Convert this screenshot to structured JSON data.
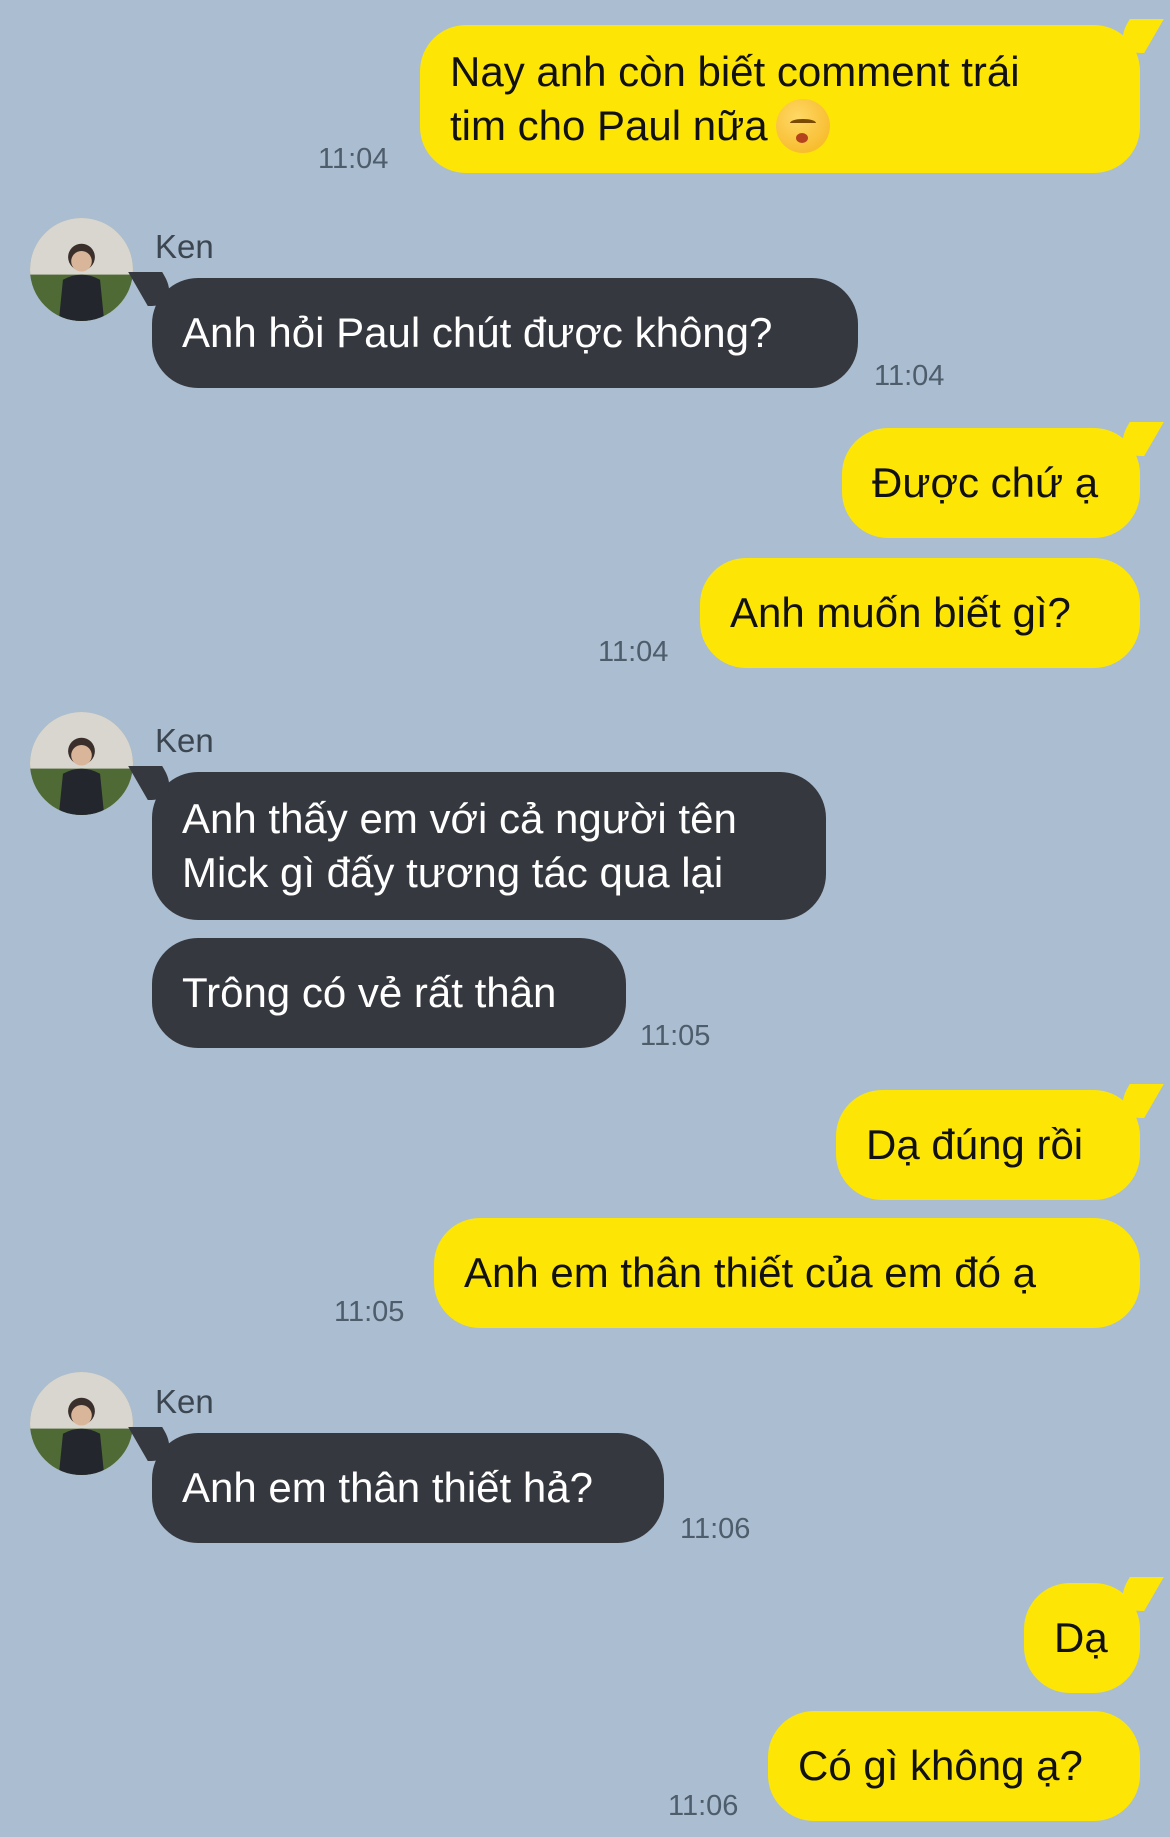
{
  "contact_name": "Ken",
  "messages": [
    {
      "from": "me",
      "text1": "Nay anh còn biết comment trái",
      "text2": "tim cho Paul nữa",
      "emoji": "kissing-face-with-closed-eyes-icon"
    },
    {
      "from": "them",
      "text": "Anh hỏi Paul chút được không?"
    },
    {
      "from": "me",
      "text": "Được chứ ạ"
    },
    {
      "from": "me",
      "text": "Anh muốn biết gì?"
    },
    {
      "from": "them",
      "text1": "Anh thấy em với cả người tên",
      "text2": "Mick gì đấy tương tác qua lại"
    },
    {
      "from": "them",
      "text": "Trông có vẻ rất thân"
    },
    {
      "from": "me",
      "text": "Dạ đúng rồi"
    },
    {
      "from": "me",
      "text": "Anh em thân thiết của em đó ạ"
    },
    {
      "from": "them",
      "text": "Anh em thân thiết hả?"
    },
    {
      "from": "me",
      "text": "Dạ"
    },
    {
      "from": "me",
      "text": "Có gì không ạ?"
    }
  ],
  "times": {
    "t1": "11:04",
    "t2": "11:04",
    "t3": "11:04",
    "t4": "11:05",
    "t5": "11:05",
    "t6": "11:06",
    "t7": "11:06"
  },
  "colors": {
    "background": "#abbdd0",
    "mine_bubble": "#fde505",
    "their_bubble": "#35383e"
  }
}
